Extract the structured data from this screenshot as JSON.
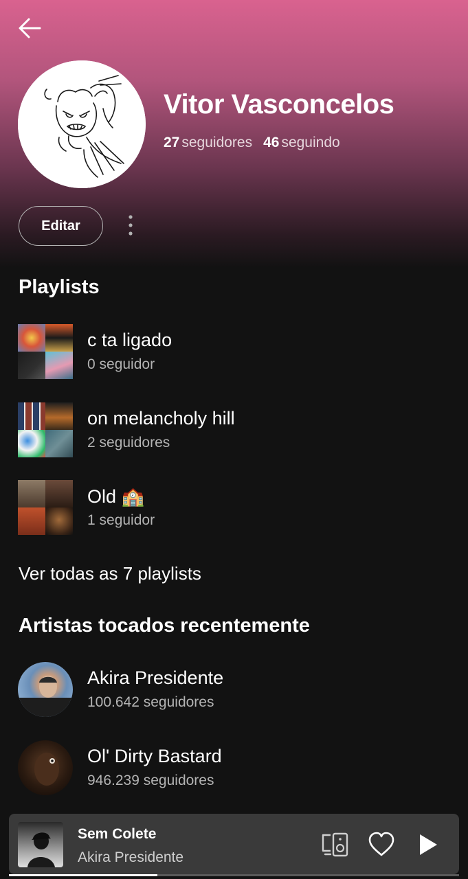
{
  "profile": {
    "name": "Vitor Vasconcelos",
    "followers_count": "27",
    "followers_label": "seguidores",
    "following_count": "46",
    "following_label": "seguindo",
    "edit_label": "Editar"
  },
  "playlists": {
    "title": "Playlists",
    "items": [
      {
        "name": "c ta ligado",
        "subtitle": "0 seguidor"
      },
      {
        "name": "on melancholy hill",
        "subtitle": "2 seguidores"
      },
      {
        "name": "Old 🏫",
        "subtitle": "1 seguidor"
      }
    ],
    "see_all": "Ver todas as 7 playlists"
  },
  "recent_artists": {
    "title": "Artistas tocados recentemente",
    "items": [
      {
        "name": "Akira Presidente",
        "subtitle": "100.642 seguidores"
      },
      {
        "name": "Ol' Dirty Bastard",
        "subtitle": "946.239 seguidores"
      }
    ]
  },
  "now_playing": {
    "title": "Sem Colete",
    "artist": "Akira Presidente",
    "progress": 0.33
  },
  "icons": {
    "back": "arrow-left-icon",
    "more": "more-vertical-icon",
    "devices": "connect-device-icon",
    "like": "heart-icon",
    "play": "play-icon"
  }
}
